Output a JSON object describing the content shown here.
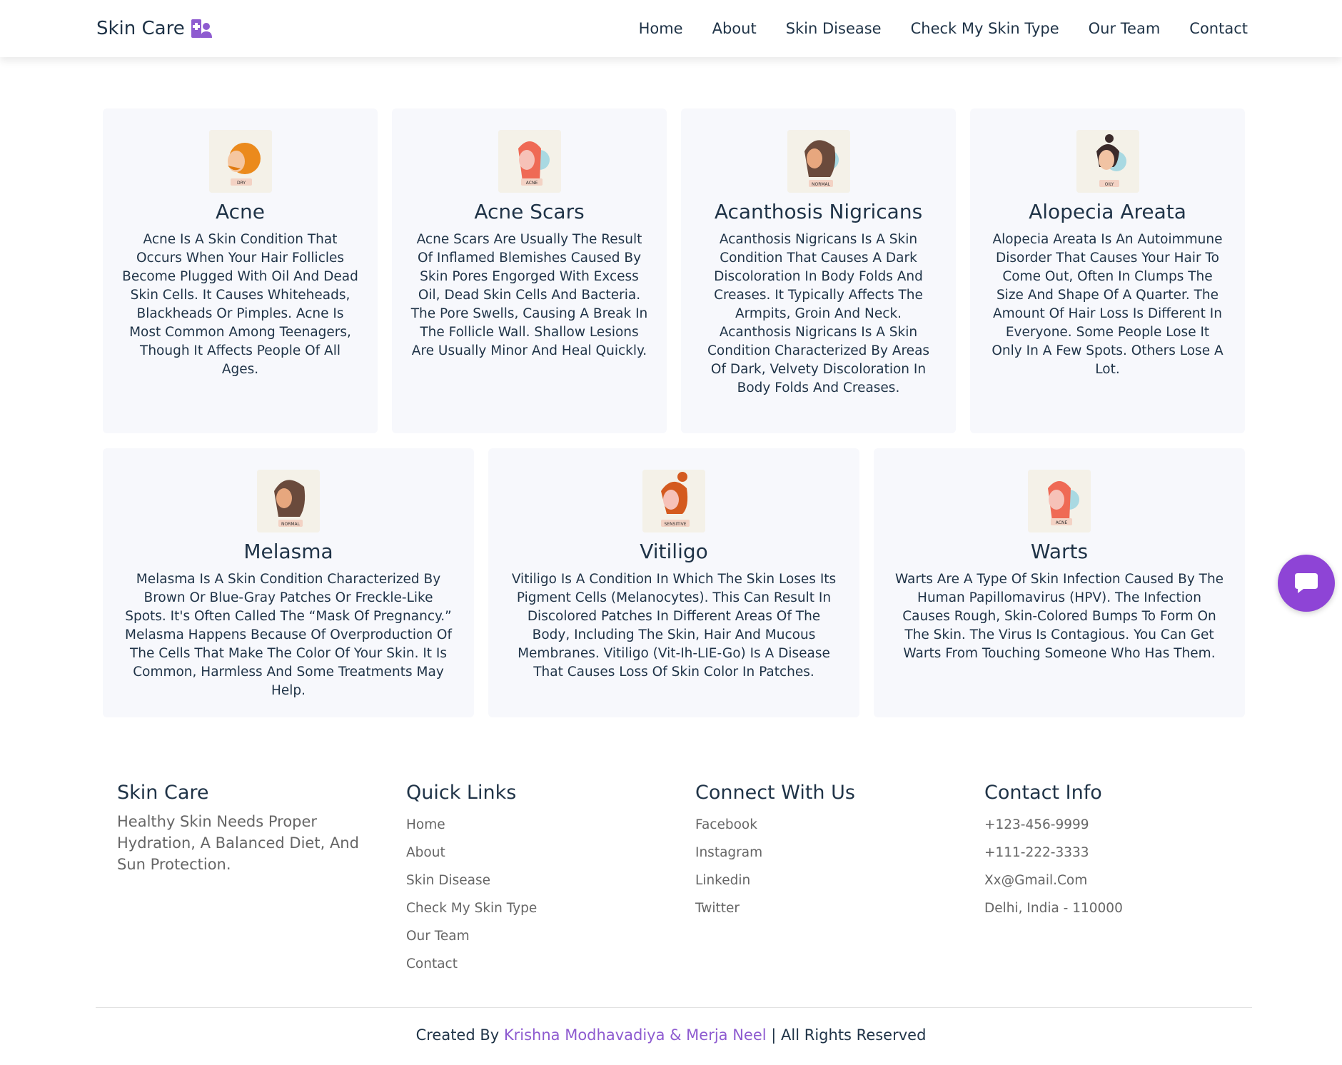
{
  "brand": {
    "name": "Skin Care",
    "icon": "doctor-user-icon",
    "accent": "#8e5bd0"
  },
  "nav": [
    "Home",
    "About",
    "Skin Disease",
    "Check My Skin Type",
    "Our Team",
    "Contact"
  ],
  "cards": [
    {
      "title": "Acne",
      "badge": "DRY",
      "text": "Acne Is A Skin Condition That Occurs When Your Hair Follicles Become Plugged With Oil And Dead Skin Cells. It Causes Whiteheads, Blackheads Or Pimples. Acne Is Most Common Among Teenagers, Though It Affects People Of All Ages."
    },
    {
      "title": "Acne Scars",
      "badge": "ACNE",
      "text": "Acne Scars Are Usually The Result Of Inflamed Blemishes Caused By Skin Pores Engorged With Excess Oil, Dead Skin Cells And Bacteria. The Pore Swells, Causing A Break In The Follicle Wall. Shallow Lesions Are Usually Minor And Heal Quickly."
    },
    {
      "title": "Acanthosis Nigricans",
      "badge": "NORMAL",
      "text": "Acanthosis Nigricans Is A Skin Condition That Causes A Dark Discoloration In Body Folds And Creases. It Typically Affects The Armpits, Groin And Neck. Acanthosis Nigricans Is A Skin Condition Characterized By Areas Of Dark, Velvety Discoloration In Body Folds And Creases."
    },
    {
      "title": "Alopecia Areata",
      "badge": "OILY",
      "text": "Alopecia Areata Is An Autoimmune Disorder That Causes Your Hair To Come Out, Often In Clumps The Size And Shape Of A Quarter. The Amount Of Hair Loss Is Different In Everyone. Some People Lose It Only In A Few Spots. Others Lose A Lot."
    },
    {
      "title": "Melasma",
      "badge": "NORMAL",
      "text": "Melasma Is A Skin Condition Characterized By Brown Or Blue-Gray Patches Or Freckle-Like Spots. It's Often Called The “Mask Of Pregnancy.” Melasma Happens Because Of Overproduction Of The Cells That Make The Color Of Your Skin. It Is Common, Harmless And Some Treatments May Help."
    },
    {
      "title": "Vitiligo",
      "badge": "SENSITIVE",
      "text": "Vitiligo Is A Condition In Which The Skin Loses Its Pigment Cells (Melanocytes). This Can Result In Discolored Patches In Different Areas Of The Body, Including The Skin, Hair And Mucous Membranes. Vitiligo (Vit-Ih-LIE-Go) Is A Disease That Causes Loss Of Skin Color In Patches."
    },
    {
      "title": "Warts",
      "badge": "ACNE",
      "text": "Warts Are A Type Of Skin Infection Caused By The Human Papillomavirus (HPV). The Infection Causes Rough, Skin-Colored Bumps To Form On The Skin. The Virus Is Contagious. You Can Get Warts From Touching Someone Who Has Them."
    }
  ],
  "footer": {
    "brand_title": "Skin Care",
    "tagline": "Healthy Skin Needs Proper Hydration, A Balanced Diet, And Sun Protection.",
    "quick_links_title": "Quick Links",
    "quick_links": [
      "Home",
      "About",
      "Skin Disease",
      "Check My Skin Type",
      "Our Team",
      "Contact"
    ],
    "connect_title": "Connect With Us",
    "connect": [
      "Facebook",
      "Instagram",
      "Linkedin",
      "Twitter"
    ],
    "contact_title": "Contact Info",
    "contact": [
      "+123-456-9999",
      "+111-222-3333",
      "Xx@Gmail.Com",
      "Delhi, India - 110000"
    ]
  },
  "credits": {
    "prefix": "Created By ",
    "names": "Krishna Modhavadiya & Merja Neel",
    "suffix": " | All Rights Reserved"
  }
}
